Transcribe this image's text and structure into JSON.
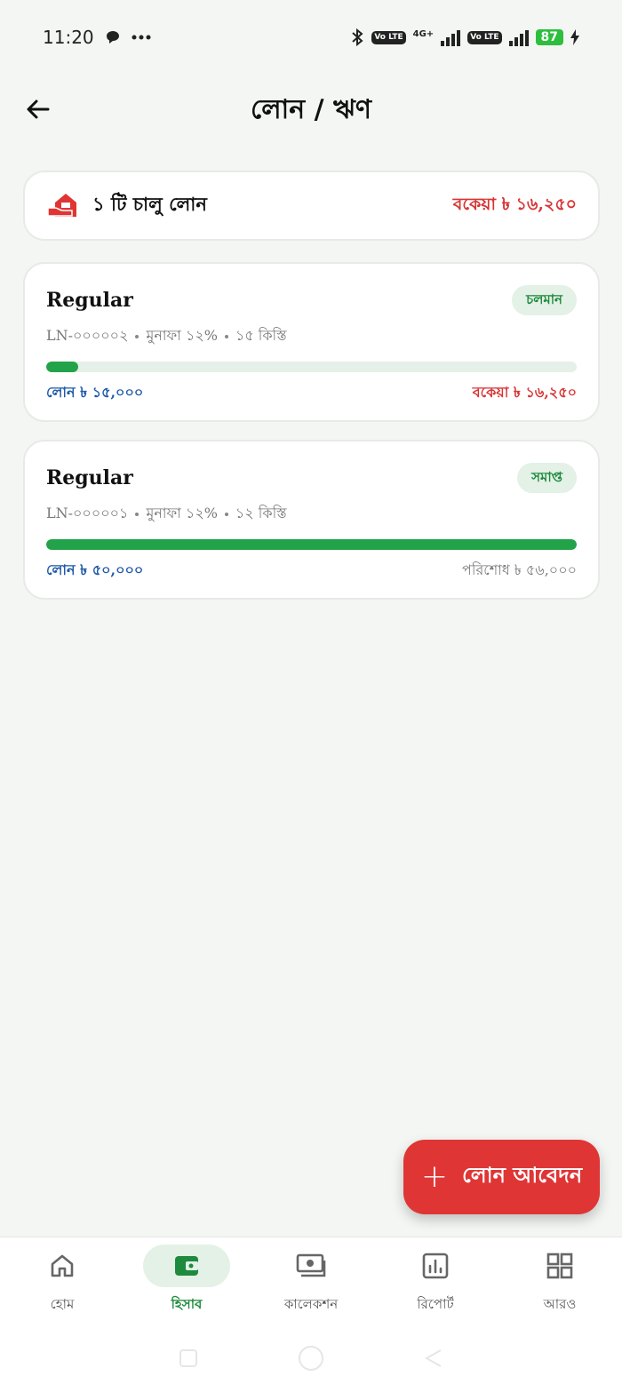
{
  "status_bar": {
    "time": "11:20",
    "network": "4G+",
    "volte": "Vo LTE",
    "battery": "87"
  },
  "header": {
    "title": "লোন / ঋণ"
  },
  "summary": {
    "label": "১ টি চালু লোন",
    "due": "বকেয়া ৳ ১৬,২৫০"
  },
  "loans": [
    {
      "type": "Regular",
      "status": "চলমান",
      "id": "LN-০০০০০২",
      "profit": "মুনাফা ১২%",
      "installments": "১৫ কিস্তি",
      "progress": 0.06,
      "amount": "লোন ৳ ১৫,০০০",
      "right": "বকেয়া ৳ ১৬,২৫০"
    },
    {
      "type": "Regular",
      "status": "সমাপ্ত",
      "id": "LN-০০০০০১",
      "profit": "মুনাফা ১২%",
      "installments": "১২ কিস্তি",
      "progress": 1.0,
      "amount": "লোন ৳ ৫০,০০০",
      "right": "পরিশোধ ৳ ৫৬,০০০"
    }
  ],
  "fab": {
    "plus": "+",
    "label": "লোন আবেদন"
  },
  "nav": {
    "items": [
      {
        "label": "হোম",
        "icon": "home-icon"
      },
      {
        "label": "হিসাব",
        "icon": "wallet-icon"
      },
      {
        "label": "কালেকশন",
        "icon": "cash-icon"
      },
      {
        "label": "রিপোর্ট",
        "icon": "chart-icon"
      },
      {
        "label": "আরও",
        "icon": "grid-icon"
      }
    ],
    "active_index": 1
  },
  "colors": {
    "accent_green": "#1e8a3d",
    "danger_red": "#e03535",
    "link_blue": "#1f5aa8"
  }
}
